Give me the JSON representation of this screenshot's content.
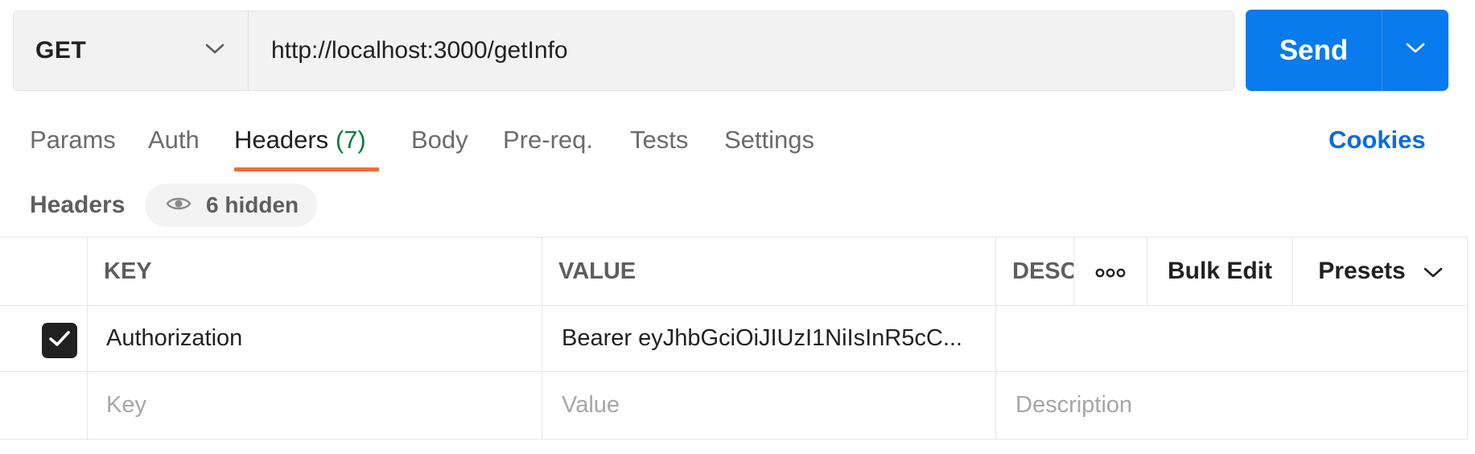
{
  "request": {
    "method": "GET",
    "url": "http://localhost:3000/getInfo",
    "send_label": "Send"
  },
  "tabs": [
    {
      "label": "Params"
    },
    {
      "label": "Auth"
    },
    {
      "label": "Headers",
      "count": "(7)",
      "active": true
    },
    {
      "label": "Body"
    },
    {
      "label": "Pre-req."
    },
    {
      "label": "Tests"
    },
    {
      "label": "Settings"
    }
  ],
  "cookies_label": "Cookies",
  "headers_section": {
    "label": "Headers",
    "hidden_label": "6 hidden"
  },
  "table": {
    "columns": {
      "key": "KEY",
      "value": "VALUE",
      "description": "DESC"
    },
    "bulk_edit_label": "Bulk Edit",
    "presets_label": "Presets",
    "rows": [
      {
        "checked": true,
        "key": "Authorization",
        "value": "Bearer eyJhbGciOiJIUzI1NiIsInR5cC..."
      }
    ],
    "new_row": {
      "key_placeholder": "Key",
      "value_placeholder": "Value",
      "description_placeholder": "Description"
    }
  },
  "colors": {
    "send_button": "#097bed",
    "active_tab_underline": "#f26b3a",
    "header_count": "#0a7c3a",
    "cookies_link": "#0b6cdb"
  },
  "icons": {
    "method_dropdown": "chevron-down-icon",
    "send_dropdown": "chevron-down-icon",
    "hidden_headers": "eye-icon",
    "more_options": "more-horizontal-icon",
    "presets_dropdown": "chevron-down-icon",
    "checkbox": "checkmark-icon"
  }
}
